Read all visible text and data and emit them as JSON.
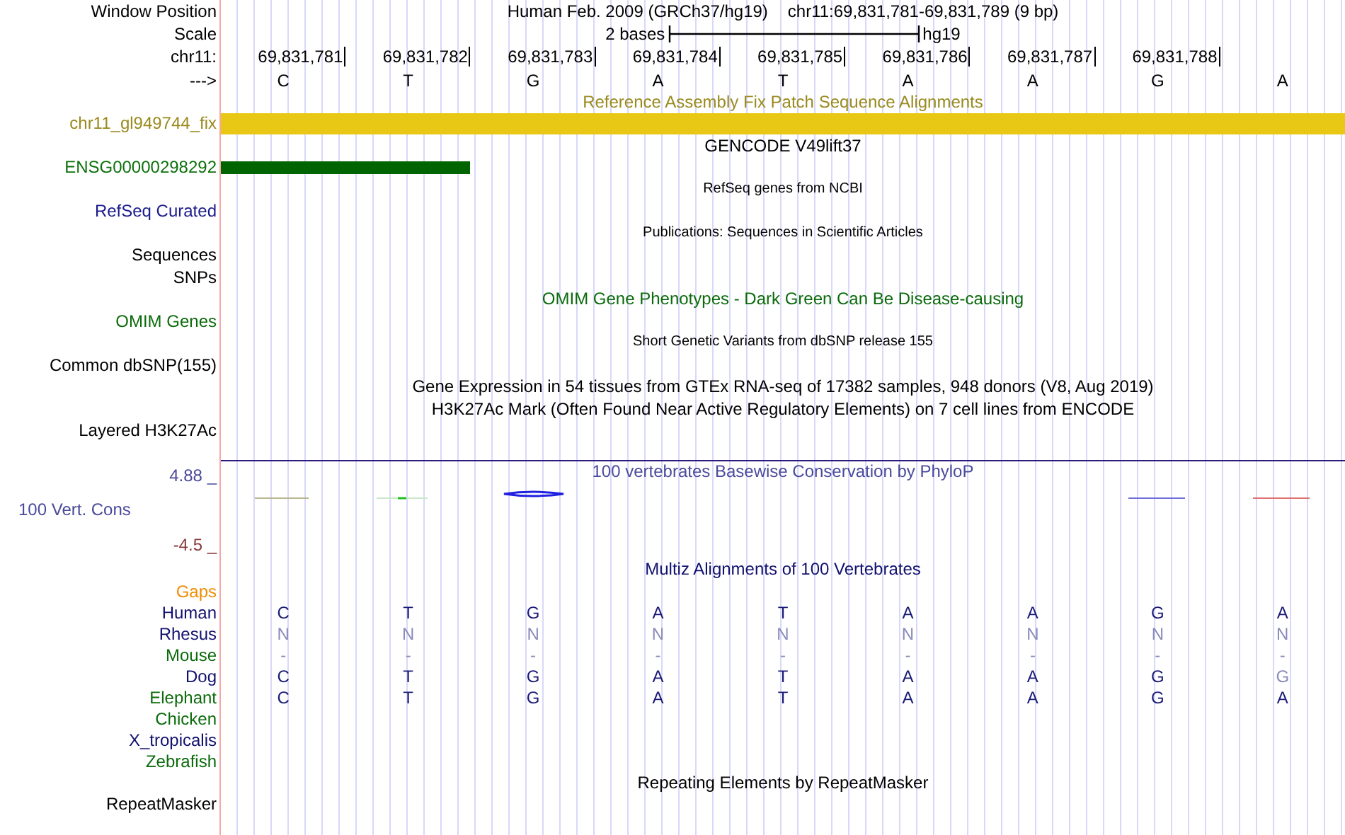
{
  "header": {
    "label": "Window Position",
    "assembly": "Human Feb. 2009 (GRCh37/hg19)",
    "position": "chr11:69,831,781-69,831,789 (9 bp)"
  },
  "scale": {
    "label": "Scale",
    "span": "2 bases",
    "assembly": "hg19"
  },
  "ruler": {
    "label": "chr11:",
    "positions": [
      "69,831,781",
      "69,831,782",
      "69,831,783",
      "69,831,784",
      "69,831,785",
      "69,831,786",
      "69,831,787",
      "69,831,788"
    ]
  },
  "sequence": {
    "label": "--->",
    "bases": [
      "C",
      "T",
      "G",
      "A",
      "T",
      "A",
      "A",
      "G",
      "A"
    ]
  },
  "tracks": [
    {
      "kind": "title",
      "title": "Reference Assembly Fix Patch Sequence Alignments",
      "color": "#9a8a1e"
    },
    {
      "kind": "patch-bar",
      "label": "chr11_gl949744_fix",
      "color": "#9a8a1e"
    },
    {
      "kind": "title",
      "title": "GENCODE V49lift37",
      "color": "#000000"
    },
    {
      "kind": "gene-bar",
      "label": "ENSG00000298292",
      "color": "#0b700b"
    },
    {
      "kind": "small-title",
      "title": "RefSeq genes from NCBI",
      "color": "#000000"
    },
    {
      "kind": "label",
      "label": "RefSeq Curated",
      "color": "#1a1a8c"
    },
    {
      "kind": "small-title",
      "title": "Publications: Sequences in Scientific Articles",
      "color": "#000000"
    },
    {
      "kind": "label",
      "label": "Sequences",
      "color": "#000000"
    },
    {
      "kind": "label",
      "label": "SNPs",
      "color": "#000000"
    },
    {
      "kind": "title",
      "title": "OMIM Gene Phenotypes - Dark Green Can Be Disease-causing",
      "color": "#0b6b0b"
    },
    {
      "kind": "label",
      "label": "OMIM Genes",
      "color": "#0b6b0b"
    },
    {
      "kind": "small-title",
      "title": "Short Genetic Variants from dbSNP release 155",
      "color": "#000000"
    },
    {
      "kind": "label",
      "label": "Common dbSNP(155)",
      "color": "#000000"
    },
    {
      "kind": "title",
      "title": "Gene Expression in 54 tissues from GTEx RNA-seq of 17382 samples, 948 donors (V8, Aug 2019)",
      "color": "#000000"
    },
    {
      "kind": "title",
      "title": "H3K27Ac Mark (Often Found Near Active Regulatory Elements) on 7 cell lines from ENCODE",
      "color": "#000000"
    },
    {
      "kind": "label",
      "label": "Layered H3K27Ac",
      "color": "#000000"
    }
  ],
  "conservation": {
    "max": "4.88 _",
    "label": "100 Vert. Cons",
    "min": "-4.5 _",
    "title": "100 vertebrates Basewise Conservation by PhyloP"
  },
  "multiz": {
    "title": "Multiz Alignments of 100 Vertebrates",
    "species": [
      {
        "species": "Gaps",
        "color": "#f08c00"
      },
      {
        "species": "Human",
        "color": "#10106e",
        "bases": [
          {
            "base": "C",
            "faint": false
          },
          {
            "base": "T",
            "faint": false
          },
          {
            "base": "G",
            "faint": false
          },
          {
            "base": "A",
            "faint": false
          },
          {
            "base": "T",
            "faint": false
          },
          {
            "base": "A",
            "faint": false
          },
          {
            "base": "A",
            "faint": false
          },
          {
            "base": "G",
            "faint": false
          },
          {
            "base": "A",
            "faint": false
          }
        ]
      },
      {
        "species": "Rhesus",
        "color": "#10106e",
        "bases": [
          {
            "base": "N",
            "faint": true
          },
          {
            "base": "N",
            "faint": true
          },
          {
            "base": "N",
            "faint": true
          },
          {
            "base": "N",
            "faint": true
          },
          {
            "base": "N",
            "faint": true
          },
          {
            "base": "N",
            "faint": true
          },
          {
            "base": "N",
            "faint": true
          },
          {
            "base": "N",
            "faint": true
          },
          {
            "base": "N",
            "faint": true
          }
        ]
      },
      {
        "species": "Mouse",
        "color": "#0b6b0b",
        "bases": [
          {
            "base": "-",
            "faint": true
          },
          {
            "base": "-",
            "faint": true
          },
          {
            "base": "-",
            "faint": true
          },
          {
            "base": "-",
            "faint": true
          },
          {
            "base": "-",
            "faint": true
          },
          {
            "base": "-",
            "faint": true
          },
          {
            "base": "-",
            "faint": true
          },
          {
            "base": "-",
            "faint": true
          },
          {
            "base": "-",
            "faint": true
          }
        ]
      },
      {
        "species": "Dog",
        "color": "#10106e",
        "bases": [
          {
            "base": "C",
            "faint": false
          },
          {
            "base": "T",
            "faint": false
          },
          {
            "base": "G",
            "faint": false
          },
          {
            "base": "A",
            "faint": false
          },
          {
            "base": "T",
            "faint": false
          },
          {
            "base": "A",
            "faint": false
          },
          {
            "base": "A",
            "faint": false
          },
          {
            "base": "G",
            "faint": false
          },
          {
            "base": "G",
            "faint": true
          }
        ]
      },
      {
        "species": "Elephant",
        "color": "#0b6b0b",
        "bases": [
          {
            "base": "C",
            "faint": false
          },
          {
            "base": "T",
            "faint": false
          },
          {
            "base": "G",
            "faint": false
          },
          {
            "base": "A",
            "faint": false
          },
          {
            "base": "T",
            "faint": false
          },
          {
            "base": "A",
            "faint": false
          },
          {
            "base": "A",
            "faint": false
          },
          {
            "base": "G",
            "faint": false
          },
          {
            "base": "A",
            "faint": false
          }
        ]
      },
      {
        "species": "Chicken",
        "color": "#0b6b0b"
      },
      {
        "species": "X_tropicalis",
        "color": "#10106e"
      },
      {
        "species": "Zebrafish",
        "color": "#0b6b0b"
      }
    ]
  },
  "lower_tracks": [
    {
      "kind": "title",
      "title": "Repeating Elements by RepeatMasker",
      "color": "#000000"
    },
    {
      "kind": "label",
      "label": "RepeatMasker",
      "color": "#000000"
    }
  ]
}
